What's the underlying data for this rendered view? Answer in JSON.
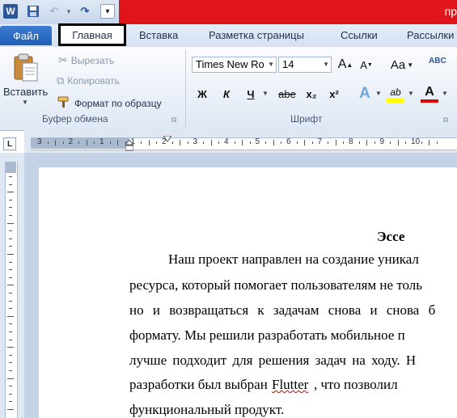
{
  "title_bar": {
    "app_icon": "W",
    "window_title": "пр"
  },
  "quick_access": {
    "save_icon": "save-icon",
    "undo_icon": "undo-icon",
    "redo_icon": "redo-icon",
    "customize_icon": "customize-qat-icon"
  },
  "tabs": {
    "file": "Файл",
    "home": "Главная",
    "insert": "Вставка",
    "page_layout": "Разметка страницы",
    "references": "Ссылки",
    "mailings": "Рассылки"
  },
  "clipboard": {
    "paste": "Вставить",
    "cut": "Вырезать",
    "copy": "Копировать",
    "format_painter": "Формат по образцу",
    "group_label": "Буфер обмена"
  },
  "font": {
    "font_name": "Times New Ro",
    "font_size": "14",
    "grow": "A",
    "shrink": "A",
    "change_case": "Aa",
    "bold": "Ж",
    "italic": "К",
    "underline": "Ч",
    "strike": "abe",
    "subscript": "x₂",
    "superscript": "x²",
    "text_effects": "A",
    "highlight": "ab",
    "font_color": "A",
    "group_label": "Шрифт"
  },
  "ruler": {
    "tab_selector": "L",
    "numbers": [
      "3",
      "2",
      "1",
      "1",
      "2",
      "3",
      "4",
      "5",
      "6",
      "7",
      "8",
      "9",
      "10"
    ]
  },
  "document": {
    "title": "Эссе",
    "lines": [
      "Наш проект направлен на создание уникал",
      "ресурса, который помогает пользователям не толь",
      "но и возвращаться к задачам снова и снова б",
      "формату. Мы решили разработать мобильное п",
      "лучше подходит для решения задач на ходу. Н",
      "разработки был выбран",
      "Flutter",
      ", что позволил",
      "функциональный продукт."
    ]
  },
  "colors": {
    "title_red": "#e0151b",
    "file_tab": "#1f5fb6",
    "highlight": "#ffff00",
    "font_color": "#e00000"
  }
}
